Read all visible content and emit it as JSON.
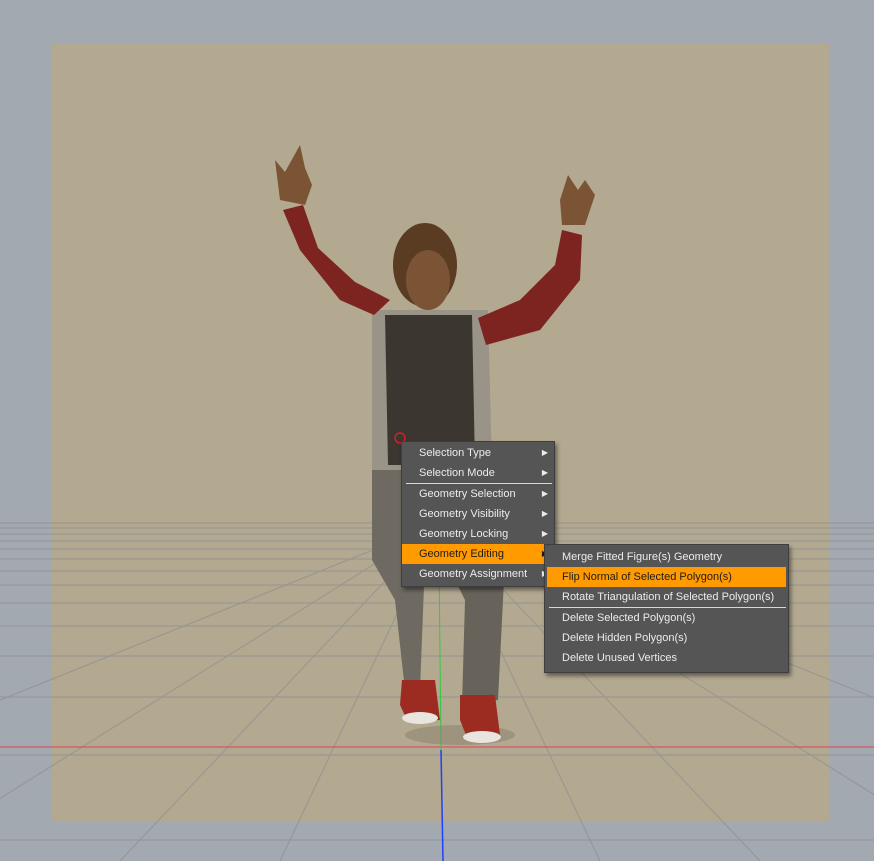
{
  "context_menu": {
    "items": [
      {
        "label": "Selection Type"
      },
      {
        "label": "Selection Mode"
      },
      {
        "label": "Geometry Selection"
      },
      {
        "label": "Geometry Visibility"
      },
      {
        "label": "Geometry Locking"
      },
      {
        "label": "Geometry Editing"
      },
      {
        "label": "Geometry Assignment"
      }
    ],
    "submenu_arrow": "▶"
  },
  "submenu": {
    "items": [
      {
        "label": "Merge Fitted Figure(s) Geometry"
      },
      {
        "label": "Flip Normal of Selected Polygon(s)"
      },
      {
        "label": "Rotate Triangulation of Selected Polygon(s)"
      },
      {
        "label": "Delete Selected Polygon(s)"
      },
      {
        "label": "Delete Hidden Polygon(s)"
      },
      {
        "label": "Delete Unused Vertices"
      }
    ]
  },
  "colors": {
    "viewport_bg": "#a3a9b0",
    "render_frame": "#b3a890",
    "menu_bg": "#555555",
    "highlight": "#ff9a00",
    "x_axis": "#e0405a",
    "y_axis": "#2ecc40",
    "z_axis": "#2040ff"
  },
  "scene": {
    "figure": "female-figure-dancing-icon"
  }
}
